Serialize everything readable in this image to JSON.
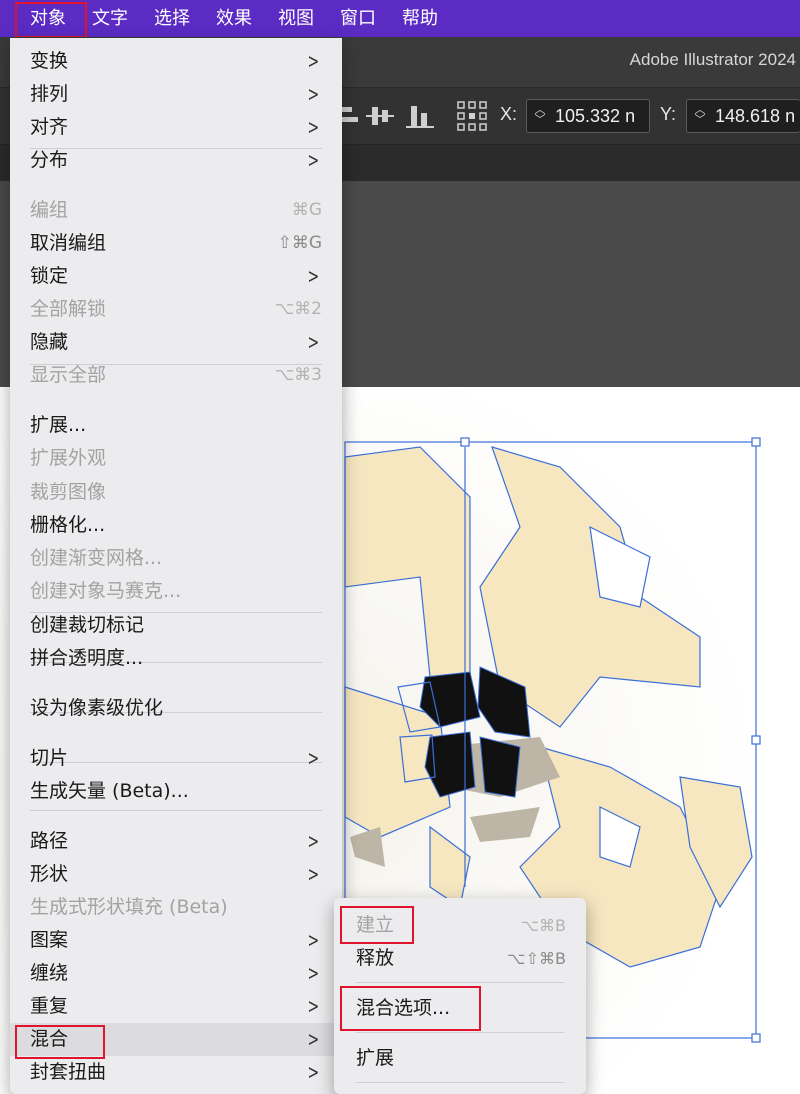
{
  "menubar": {
    "items": [
      "对象",
      "文字",
      "选择",
      "效果",
      "视图",
      "窗口",
      "帮助"
    ]
  },
  "app": {
    "title": "Adobe Illustrator 2024"
  },
  "controlbar": {
    "x_label": "X:",
    "x_value": "105.332 n",
    "y_label": "Y:",
    "y_value": "148.618 n"
  },
  "object_menu": {
    "items": [
      {
        "label": "变换",
        "submenu": true
      },
      {
        "label": "排列",
        "submenu": true
      },
      {
        "label": "对齐",
        "submenu": true
      },
      {
        "label": "分布",
        "submenu": true
      },
      {
        "label": "编组",
        "shortcut": "⌘G",
        "disabled": true
      },
      {
        "label": "取消编组",
        "shortcut": "⇧⌘G"
      },
      {
        "label": "锁定",
        "submenu": true
      },
      {
        "label": "全部解锁",
        "shortcut": "⌥⌘2",
        "disabled": true
      },
      {
        "label": "隐藏",
        "submenu": true
      },
      {
        "label": "显示全部",
        "shortcut": "⌥⌘3",
        "disabled": true
      },
      {
        "label": "扩展..."
      },
      {
        "label": "扩展外观",
        "disabled": true
      },
      {
        "label": "裁剪图像",
        "disabled": true
      },
      {
        "label": "栅格化..."
      },
      {
        "label": "创建渐变网格...",
        "disabled": true
      },
      {
        "label": "创建对象马赛克...",
        "disabled": true
      },
      {
        "label": "创建裁切标记"
      },
      {
        "label": "拼合透明度..."
      },
      {
        "label": "设为像素级优化"
      },
      {
        "label": "切片",
        "submenu": true
      },
      {
        "label": "生成矢量 (Beta)..."
      },
      {
        "label": "路径",
        "submenu": true
      },
      {
        "label": "形状",
        "submenu": true
      },
      {
        "label": "生成式形状填充 (Beta)",
        "disabled": true
      },
      {
        "label": "图案",
        "submenu": true
      },
      {
        "label": "缠绕",
        "submenu": true
      },
      {
        "label": "重复",
        "submenu": true
      },
      {
        "label": "混合",
        "submenu": true,
        "highlighted": true
      },
      {
        "label": "封套扭曲",
        "submenu": true
      }
    ],
    "arrow_glyph": ">"
  },
  "blend_submenu": {
    "items": [
      {
        "label": "建立",
        "shortcut": "⌥⌘B",
        "disabled": true
      },
      {
        "label": "释放",
        "shortcut": "⌥⇧⌘B"
      },
      {
        "label": "混合选项..."
      },
      {
        "label": "扩展"
      }
    ]
  },
  "artwork": {
    "fill_color": "#f6e7c1",
    "selection_color": "#3b6fd8",
    "accent_highlight": "#e0142e"
  }
}
